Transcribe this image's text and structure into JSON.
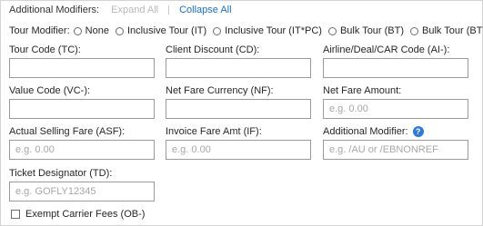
{
  "header": {
    "title": "Additional Modifiers:",
    "expand_all": "Expand All",
    "separator": "|",
    "collapse_all": "Collapse All"
  },
  "tour_modifier": {
    "label": "Tour Modifier:",
    "options": [
      "None",
      "Inclusive Tour (IT)",
      "Inclusive Tour (IT*PC)",
      "Bulk Tour (BT)",
      "Bulk Tour (BT*PC)"
    ]
  },
  "fields": {
    "tour_code": {
      "label": "Tour Code (TC):",
      "value": "",
      "placeholder": ""
    },
    "client_discount": {
      "label": "Client Discount (CD):",
      "value": "",
      "placeholder": ""
    },
    "airline_deal_car_code": {
      "label": "Airline/Deal/CAR Code (AI-):",
      "value": "",
      "placeholder": ""
    },
    "value_code": {
      "label": "Value Code (VC-):",
      "value": "",
      "placeholder": ""
    },
    "net_fare_currency": {
      "label": "Net Fare Currency (NF):",
      "value": "",
      "placeholder": ""
    },
    "net_fare_amount": {
      "label": "Net Fare Amount:",
      "value": "",
      "placeholder": "e.g. 0.00"
    },
    "actual_selling_fare": {
      "label": "Actual Selling Fare (ASF):",
      "value": "",
      "placeholder": "e.g. 0.00"
    },
    "invoice_fare_amt": {
      "label": "Invoice Fare Amt (IF):",
      "value": "",
      "placeholder": "e.g. 0.00"
    },
    "additional_modifier": {
      "label": "Additional Modifier:",
      "value": "",
      "placeholder": "e.g. /AU or /EBNONREF",
      "help_icon": "?"
    },
    "ticket_designator": {
      "label": "Ticket Designator (TD):",
      "value": "",
      "placeholder": "e.g. GOFLY12345"
    }
  },
  "exempt_carrier_fees": {
    "label": "Exempt Carrier Fees (OB-)",
    "checked": false
  },
  "colors": {
    "link": "#1f6fb8",
    "link_disabled": "#b8b8b8",
    "help_icon": "#2f7bd4",
    "input_border": "#9a9a9a"
  }
}
